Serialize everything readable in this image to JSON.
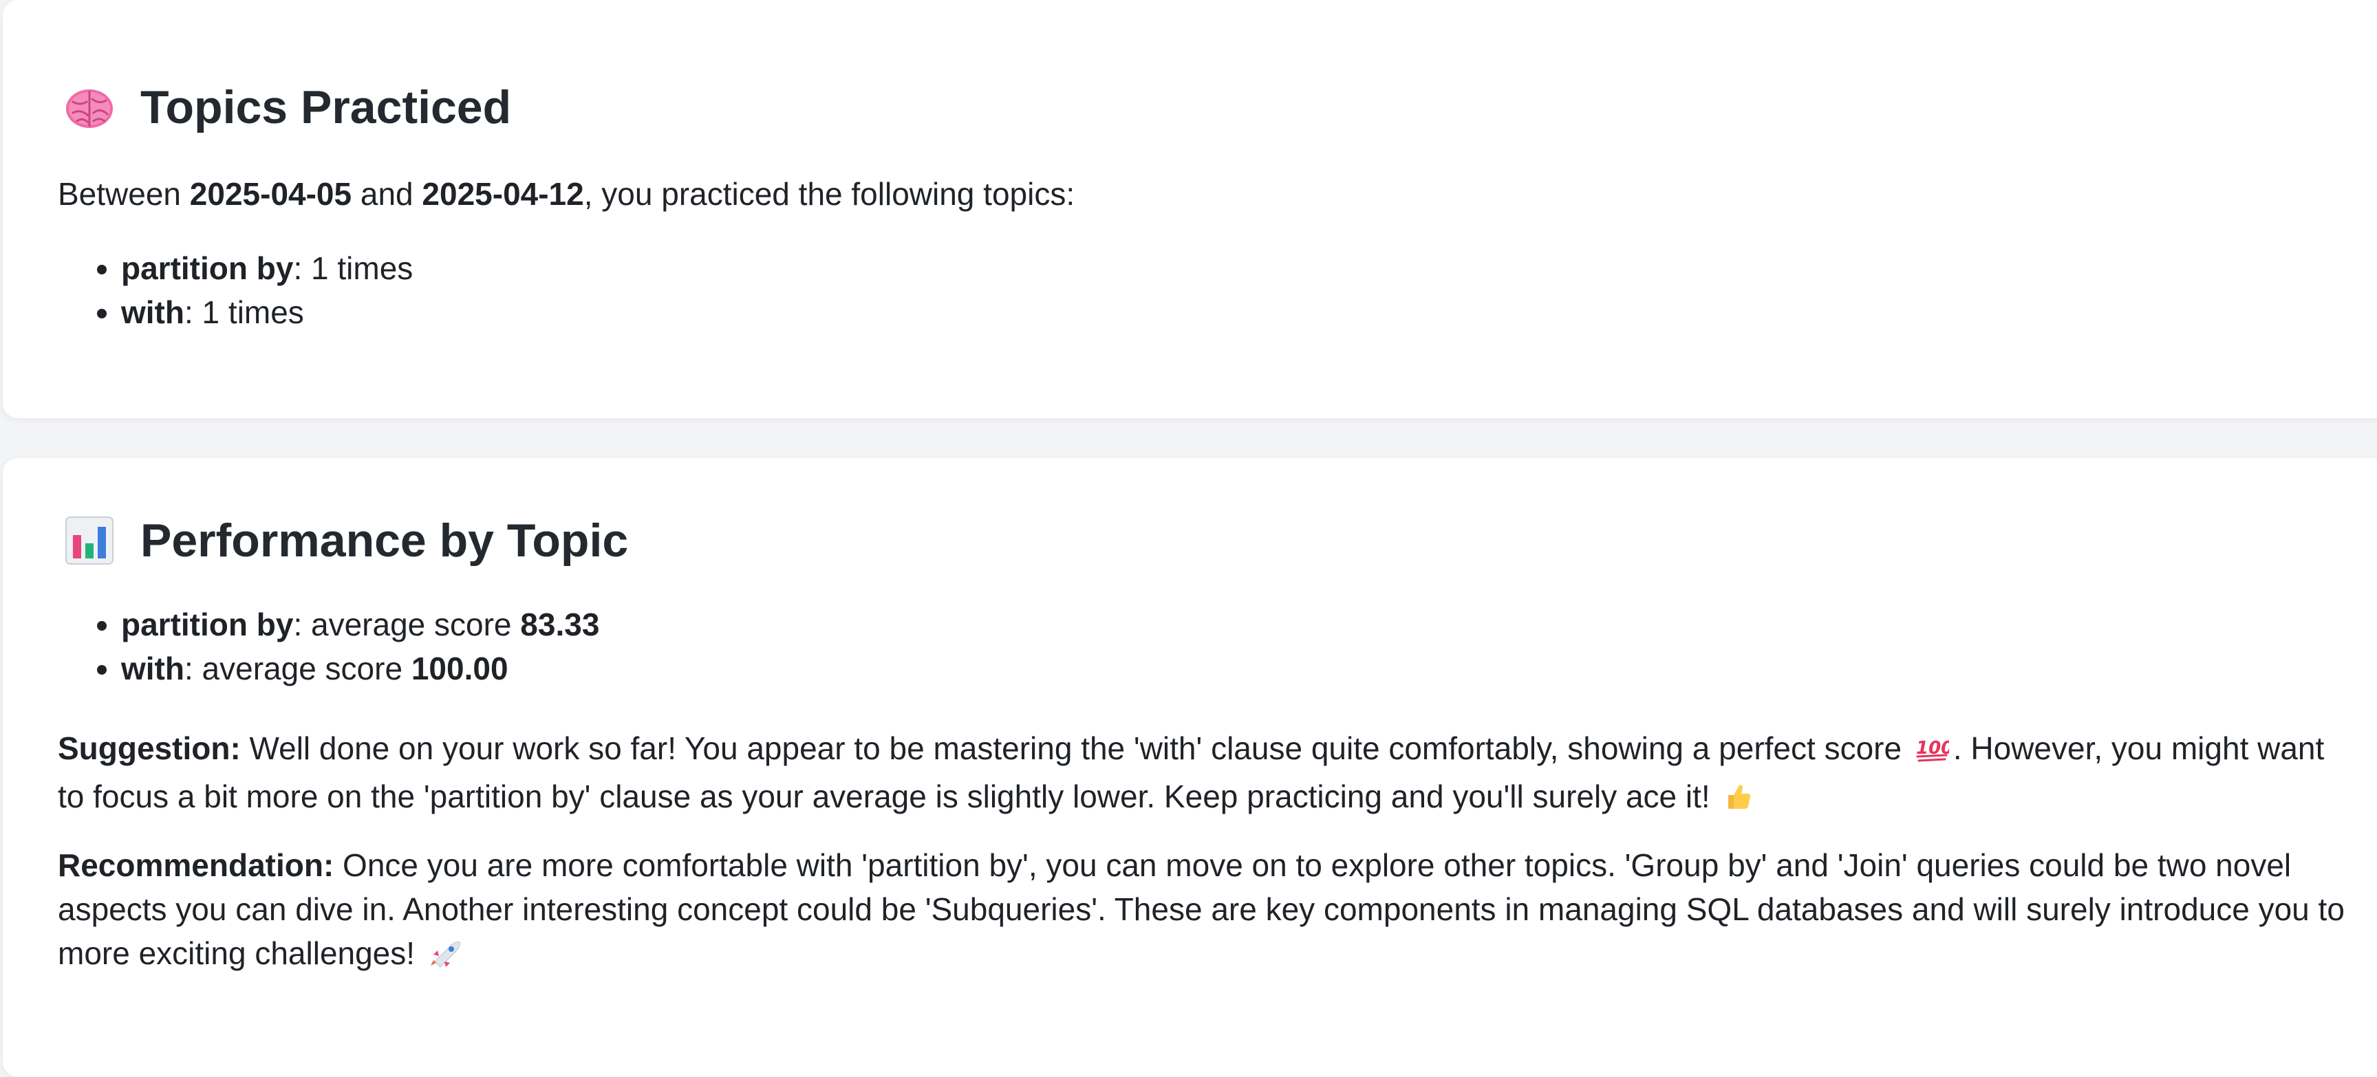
{
  "topics_card": {
    "icon": "brain-icon",
    "title": "Topics Practiced",
    "intro_prefix": "Between ",
    "start_date": "2025-04-05",
    "intro_and": " and ",
    "end_date": "2025-04-12",
    "intro_suffix": ", you practiced the following topics:",
    "items": [
      {
        "name": "partition by",
        "sep": ": ",
        "value": "1 times"
      },
      {
        "name": "with",
        "sep": ": ",
        "value": "1 times"
      }
    ]
  },
  "performance_card": {
    "icon": "bar-chart-icon",
    "title": "Performance by Topic",
    "items": [
      {
        "name": "partition by",
        "mid": ": average score ",
        "score": "83.33"
      },
      {
        "name": "with",
        "mid": ": average score ",
        "score": "100.00"
      }
    ],
    "suggestion": {
      "label": "Suggestion:",
      "text_part1": " Well done on your work so far! You appear to be mastering the 'with' clause quite comfortably, showing a perfect score",
      "emoji1": "hundred-points-icon",
      "text_part2": ". However, you might want to focus a bit more on the 'partition by' clause as your average is slightly lower. Keep practicing and you'll surely ace it!",
      "emoji2": "thumbs-up-icon"
    },
    "recommendation": {
      "label": "Recommendation:",
      "text": " Once you are more comfortable with 'partition by', you can move on to explore other topics. 'Group by' and 'Join' queries could be two novel aspects you can dive in. Another interesting concept could be 'Subqueries'. These are key components in managing SQL databases and will surely introduce you to more exciting challenges!",
      "emoji": "rocket-icon"
    }
  },
  "colors": {
    "background": "#f3f4f6",
    "card": "#ffffff",
    "text": "#1f2328",
    "brain": "#f26aa6",
    "chart_bars": [
      "#e8457b",
      "#23b37a",
      "#3d7ddb"
    ]
  }
}
